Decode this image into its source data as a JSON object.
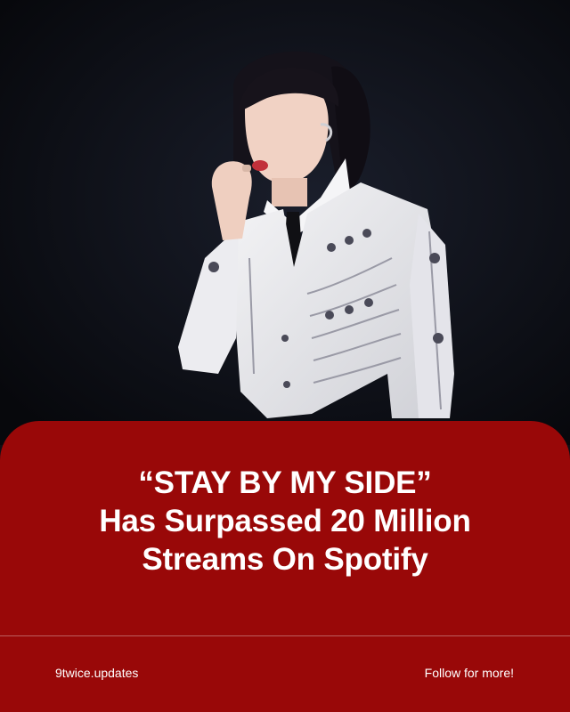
{
  "colors": {
    "background": "#0d0f16",
    "card": "#990808",
    "text": "#ffffff"
  },
  "photo": {
    "subject": "performer in white embellished jacket singing on dark stage"
  },
  "headline": {
    "line1": "“STAY BY MY SIDE”",
    "line2": "Has Surpassed 20 Million",
    "line3": "Streams On Spotify"
  },
  "footer": {
    "handle": "9twice.updates",
    "cta": "Follow for more!"
  }
}
